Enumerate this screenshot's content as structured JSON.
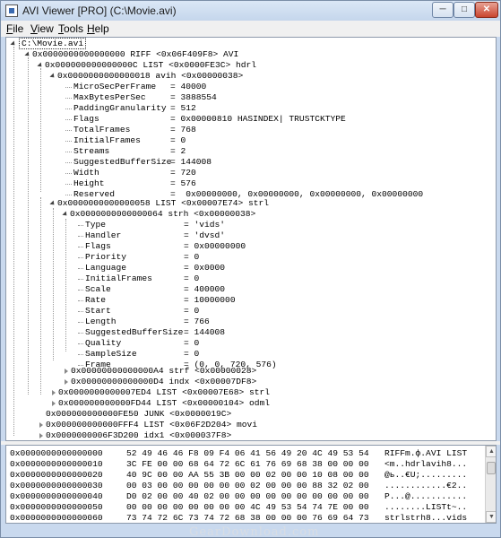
{
  "window": {
    "title": "AVI Viewer [PRO] (C:\\Movie.avi)"
  },
  "menu": [
    {
      "label": "File",
      "accel": "F"
    },
    {
      "label": "View",
      "accel": "V"
    },
    {
      "label": "Tools",
      "accel": "T"
    },
    {
      "label": "Help",
      "accel": "H"
    }
  ],
  "tree": {
    "root": "C:\\Movie.avi",
    "riff": "0x0000000000000000 RIFF <0x06F409F8> AVI",
    "hdrl": "0x000000000000000C LIST <0x0000FE3C> hdrl",
    "avih": "0x0000000000000018 avih <0x00000038>",
    "avih_fields": [
      {
        "key": "MicroSecPerFrame",
        "value": "40000"
      },
      {
        "key": "MaxBytesPerSec",
        "value": "3888554"
      },
      {
        "key": "PaddingGranularity",
        "value": "512"
      },
      {
        "key": "Flags",
        "value": "0x00000810 HASINDEX| TRUSTCKTYPE"
      },
      {
        "key": "TotalFrames",
        "value": "768"
      },
      {
        "key": "InitialFrames",
        "value": "0"
      },
      {
        "key": "Streams",
        "value": "2"
      },
      {
        "key": "SuggestedBufferSize",
        "value": "144008"
      },
      {
        "key": "Width",
        "value": "720"
      },
      {
        "key": "Height",
        "value": "576"
      },
      {
        "key": "Reserved",
        "value": " 0x00000000, 0x00000000, 0x00000000, 0x00000000"
      }
    ],
    "strl": "0x0000000000000058 LIST <0x00007E74> strl",
    "strh": "0x0000000000000064 strh <0x00000038>",
    "strh_fields": [
      {
        "key": "Type",
        "value": "'vids'"
      },
      {
        "key": "Handler",
        "value": "'dvsd'"
      },
      {
        "key": "Flags",
        "value": "0x00000000"
      },
      {
        "key": "Priority",
        "value": "0"
      },
      {
        "key": "Language",
        "value": "0x0000"
      },
      {
        "key": "InitialFrames",
        "value": "0"
      },
      {
        "key": "Scale",
        "value": "400000"
      },
      {
        "key": "Rate",
        "value": "10000000"
      },
      {
        "key": "Start",
        "value": "0"
      },
      {
        "key": "Length",
        "value": "766"
      },
      {
        "key": "SuggestedBufferSize",
        "value": "144008"
      },
      {
        "key": "Quality",
        "value": "0"
      },
      {
        "key": "SampleSize",
        "value": "0"
      },
      {
        "key": "Frame",
        "value": "(0, 0, 720, 576)"
      }
    ],
    "strf": "0x00000000000000A4 strf <0x00000028>",
    "indx": "0x00000000000000D4 indx <0x00007DF8>",
    "strl2": "0x0000000000007ED4 LIST <0x00007E68> strl",
    "odml": "0x000000000000FD44 LIST <0x00000104> odml",
    "junk": "0x000000000000FE50 JUNK <0x0000019C>",
    "movi": "0x000000000000FFF4 LIST <0x06F2D204> movi",
    "idx1": "0x0000000006F3D200 idx1 <0x000037F8>"
  },
  "hex": [
    {
      "offset": "0x0000000000000000",
      "bytes": "52 49 46 46 F8 09 F4 06 41 56 49 20 4C 49 53 54",
      "ascii": "RIFFm.ф.AVI LIST"
    },
    {
      "offset": "0x0000000000000010",
      "bytes": "3C FE 00 00 68 64 72 6C 61 76 69 68 38 00 00 00",
      "ascii": "<m..hdrlavih8..."
    },
    {
      "offset": "0x0000000000000020",
      "bytes": "40 9C 00 00 AA 55 3B 00 00 02 00 00 10 08 00 00",
      "ascii": "@ь..€U;........."
    },
    {
      "offset": "0x0000000000000030",
      "bytes": "00 03 00 00 00 00 00 00 02 00 00 00 88 32 02 00",
      "ascii": "............€2.."
    },
    {
      "offset": "0x0000000000000040",
      "bytes": "D0 02 00 00 40 02 00 00 00 00 00 00 00 00 00 00",
      "ascii": "Р...@..........."
    },
    {
      "offset": "0x0000000000000050",
      "bytes": "00 00 00 00 00 00 00 00 4C 49 53 54 74 7E 00 00",
      "ascii": "........LISTt~.."
    },
    {
      "offset": "0x0000000000000060",
      "bytes": "73 74 72 6C 73 74 72 68 38 00 00 00 76 69 64 73",
      "ascii": "strlstrh8...vids"
    }
  ],
  "watermark": "GearDownload.com"
}
